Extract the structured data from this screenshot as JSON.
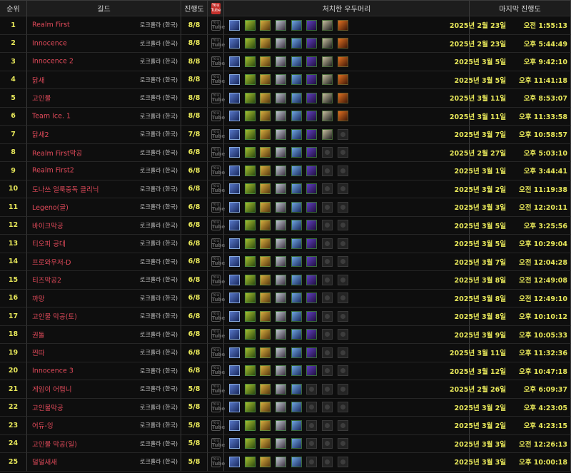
{
  "headers": {
    "rank": "순위",
    "guild": "길드",
    "progress": "진행도",
    "youtube": "You Tube",
    "bosses": "처치한 우두머리",
    "last": "마지막 진행도"
  },
  "boss_icons": [
    "boss-1-icon",
    "boss-2-icon",
    "boss-3-icon",
    "boss-4-icon",
    "boss-5-icon",
    "boss-6-icon",
    "boss-7-icon",
    "boss-8-icon"
  ],
  "rows": [
    {
      "rank": "1",
      "guild": "Realm First",
      "server": "로크홀라 (한국)",
      "progress": "8/8",
      "date": "2025년 2월 23일",
      "time": "오전 1:55:13"
    },
    {
      "rank": "2",
      "guild": "Innocence",
      "server": "로크홀라 (한국)",
      "progress": "8/8",
      "date": "2025년 2월 23일",
      "time": "오후 5:44:49"
    },
    {
      "rank": "3",
      "guild": "Innocence 2",
      "server": "로크홀라 (한국)",
      "progress": "8/8",
      "date": "2025년 3월 5일",
      "time": "오후 9:42:10"
    },
    {
      "rank": "4",
      "guild": "닭새",
      "server": "로크홀라 (한국)",
      "progress": "8/8",
      "date": "2025년 3월 5일",
      "time": "오후 11:41:18"
    },
    {
      "rank": "5",
      "guild": "고인물",
      "server": "로크홀라 (한국)",
      "progress": "8/8",
      "date": "2025년 3월 11일",
      "time": "오후 8:53:07"
    },
    {
      "rank": "6",
      "guild": "Team Ice. 1",
      "server": "로크홀라 (한국)",
      "progress": "8/8",
      "date": "2025년 3월 11일",
      "time": "오후 11:33:58"
    },
    {
      "rank": "7",
      "guild": "닭새2",
      "server": "로크홀라 (한국)",
      "progress": "7/8",
      "date": "2025년 3월 7일",
      "time": "오후 10:58:57"
    },
    {
      "rank": "8",
      "guild": "Realm First막공",
      "server": "로크홀라 (한국)",
      "progress": "6/8",
      "date": "2025년 2월 27일",
      "time": "오후 5:03:10"
    },
    {
      "rank": "9",
      "guild": "Realm First2",
      "server": "로크홀라 (한국)",
      "progress": "6/8",
      "date": "2025년 3월 1일",
      "time": "오후 3:44:41"
    },
    {
      "rank": "10",
      "guild": "도나쓰 얼룩중독 클리닉",
      "server": "로크홀라 (한국)",
      "progress": "6/8",
      "date": "2025년 3월 2일",
      "time": "오전 11:19:38"
    },
    {
      "rank": "11",
      "guild": "Legeno(글)",
      "server": "로크홀라 (한국)",
      "progress": "6/8",
      "date": "2025년 3월 3일",
      "time": "오전 12:20:11"
    },
    {
      "rank": "12",
      "guild": "바이크막공",
      "server": "로크홀라 (한국)",
      "progress": "6/8",
      "date": "2025년 3월 5일",
      "time": "오후 3:25:56"
    },
    {
      "rank": "13",
      "guild": "티오피 공대",
      "server": "로크홀라 (한국)",
      "progress": "6/8",
      "date": "2025년 3월 5일",
      "time": "오후 10:29:04"
    },
    {
      "rank": "14",
      "guild": "프로와우저-D",
      "server": "로크홀라 (한국)",
      "progress": "6/8",
      "date": "2025년 3월 7일",
      "time": "오전 12:04:28"
    },
    {
      "rank": "15",
      "guild": "티즈막공2",
      "server": "로크홀라 (한국)",
      "progress": "6/8",
      "date": "2025년 3월 8일",
      "time": "오전 12:49:08"
    },
    {
      "rank": "16",
      "guild": "까망",
      "server": "로크홀라 (한국)",
      "progress": "6/8",
      "date": "2025년 3월 8일",
      "time": "오전 12:49:10"
    },
    {
      "rank": "17",
      "guild": "고인물 막공(토)",
      "server": "로크홀라 (한국)",
      "progress": "6/8",
      "date": "2025년 3월 8일",
      "time": "오후 10:10:12"
    },
    {
      "rank": "18",
      "guild": "권돌",
      "server": "로크홀라 (한국)",
      "progress": "6/8",
      "date": "2025년 3월 9일",
      "time": "오후 10:05:33"
    },
    {
      "rank": "19",
      "guild": "찐따",
      "server": "로크홀라 (한국)",
      "progress": "6/8",
      "date": "2025년 3월 11일",
      "time": "오후 11:32:36"
    },
    {
      "rank": "20",
      "guild": "Innocence 3",
      "server": "로크홀라 (한국)",
      "progress": "6/8",
      "date": "2025년 3월 12일",
      "time": "오후 10:47:18"
    },
    {
      "rank": "21",
      "guild": "게임이 어렵니",
      "server": "로크홀라 (한국)",
      "progress": "5/8",
      "date": "2025년 2월 26일",
      "time": "오후 6:09:37"
    },
    {
      "rank": "22",
      "guild": "고인물막공",
      "server": "로크홀라 (한국)",
      "progress": "5/8",
      "date": "2025년 3월 2일",
      "time": "오후 4:23:05"
    },
    {
      "rank": "23",
      "guild": "어듀-잉",
      "server": "로크홀라 (한국)",
      "progress": "5/8",
      "date": "2025년 3월 2일",
      "time": "오후 4:23:15"
    },
    {
      "rank": "24",
      "guild": "고인물 막공(일)",
      "server": "로크홀라 (한국)",
      "progress": "5/8",
      "date": "2025년 3월 3일",
      "time": "오전 12:26:13"
    },
    {
      "rank": "25",
      "guild": "덜덜새새",
      "server": "로크홀라 (한국)",
      "progress": "5/8",
      "date": "2025년 3월 3일",
      "time": "오후 10:00:18"
    }
  ]
}
